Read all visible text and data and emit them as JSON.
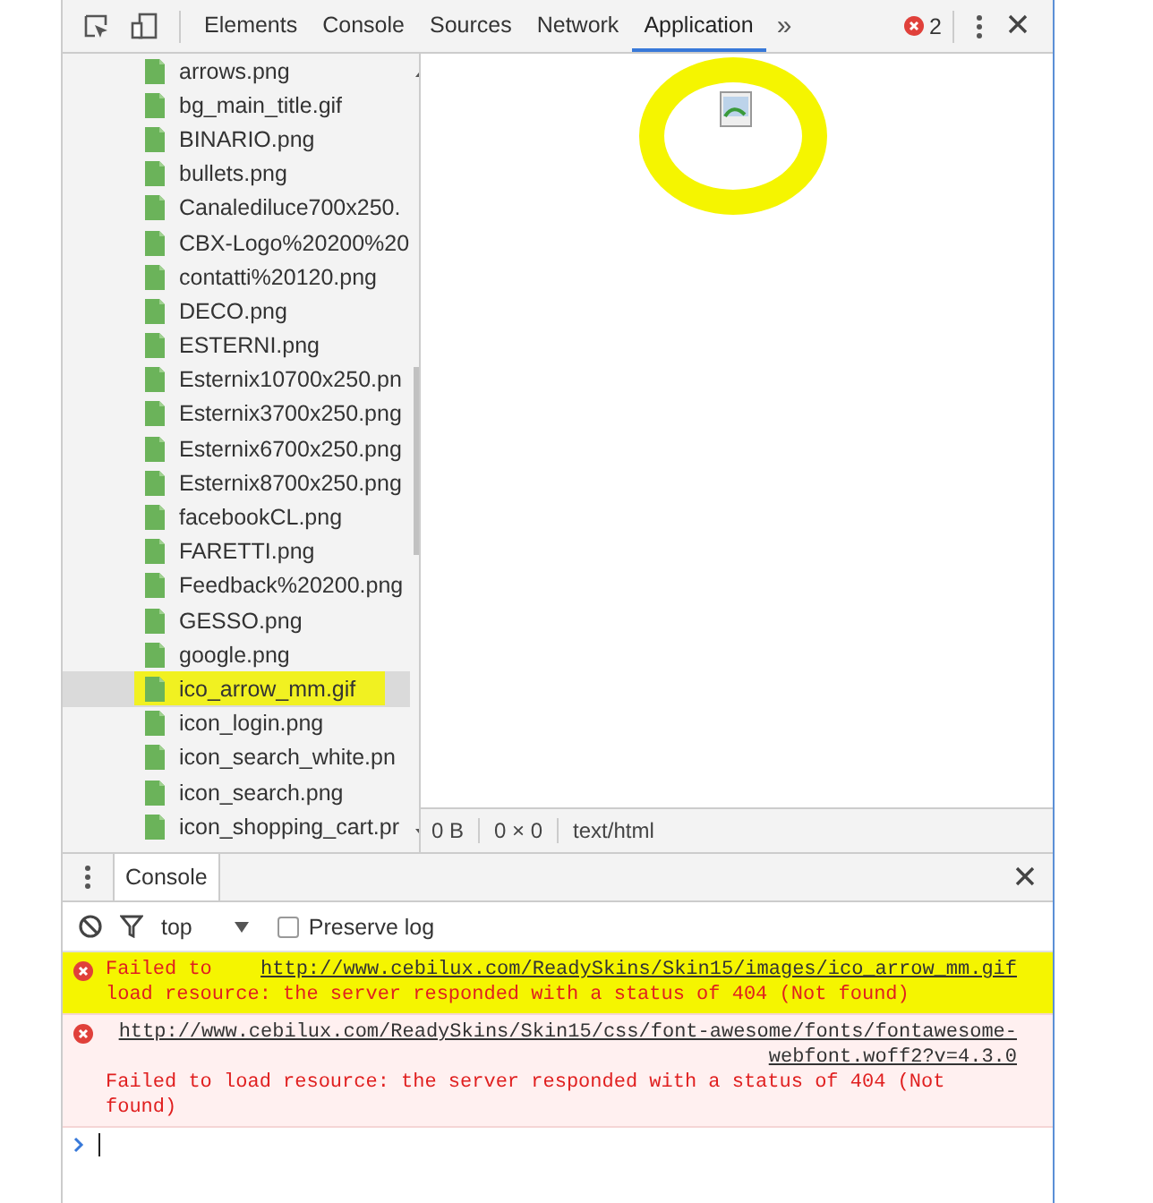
{
  "toolbar": {
    "tabs": [
      {
        "label": "Elements",
        "selected": false
      },
      {
        "label": "Console",
        "selected": false
      },
      {
        "label": "Sources",
        "selected": false
      },
      {
        "label": "Network",
        "selected": false
      },
      {
        "label": "Application",
        "selected": true
      }
    ],
    "more": "»",
    "error_count": "2"
  },
  "files": [
    {
      "name": "arrows.png",
      "selected": false,
      "highlighted": false
    },
    {
      "name": "bg_main_title.gif",
      "selected": false,
      "highlighted": false
    },
    {
      "name": "BINARIO.png",
      "selected": false,
      "highlighted": false
    },
    {
      "name": "bullets.png",
      "selected": false,
      "highlighted": false
    },
    {
      "name": "Canalediluce700x250.",
      "selected": false,
      "highlighted": false
    },
    {
      "name": "CBX-Logo%20200%20",
      "selected": false,
      "highlighted": false
    },
    {
      "name": "contatti%20120.png",
      "selected": false,
      "highlighted": false
    },
    {
      "name": "DECO.png",
      "selected": false,
      "highlighted": false
    },
    {
      "name": "ESTERNI.png",
      "selected": false,
      "highlighted": false
    },
    {
      "name": "Esternix10700x250.pn",
      "selected": false,
      "highlighted": false
    },
    {
      "name": "Esternix3700x250.png",
      "selected": false,
      "highlighted": false
    },
    {
      "name": "Esternix6700x250.png",
      "selected": false,
      "highlighted": false
    },
    {
      "name": "Esternix8700x250.png",
      "selected": false,
      "highlighted": false
    },
    {
      "name": "facebookCL.png",
      "selected": false,
      "highlighted": false
    },
    {
      "name": "FARETTI.png",
      "selected": false,
      "highlighted": false
    },
    {
      "name": "Feedback%20200.png",
      "selected": false,
      "highlighted": false
    },
    {
      "name": "GESSO.png",
      "selected": false,
      "highlighted": false
    },
    {
      "name": "google.png",
      "selected": false,
      "highlighted": false
    },
    {
      "name": "ico_arrow_mm.gif",
      "selected": true,
      "highlighted": true
    },
    {
      "name": "icon_login.png",
      "selected": false,
      "highlighted": false
    },
    {
      "name": "icon_search_white.pn",
      "selected": false,
      "highlighted": false
    },
    {
      "name": "icon_search.png",
      "selected": false,
      "highlighted": false
    },
    {
      "name": "icon_shopping_cart.pr",
      "selected": false,
      "highlighted": false
    }
  ],
  "preview": {
    "highlighted": true,
    "status": [
      "0 B",
      "0 × 0",
      "text/html"
    ]
  },
  "drawer": {
    "tabs": [
      {
        "label": "Console",
        "selected": true
      }
    ],
    "context": "top",
    "preserve_log": {
      "label": "Preserve log",
      "checked": false
    },
    "messages": [
      {
        "prefix": "Failed to",
        "url": "http://www.cebilux.com/ReadySkins/Skin15/images/ico_arrow_mm.gif",
        "text": "load resource: the server responded with a status of 404 (Not found)",
        "highlighted": true
      },
      {
        "url": "http://www.cebilux.com/ReadySkins/Skin15/css/font-awesome/fonts/fontawesome-webfont.woff2?v=4.3.0",
        "text": "Failed to load resource: the server responded with a status of 404 (Not found)",
        "highlighted": false
      }
    ]
  }
}
